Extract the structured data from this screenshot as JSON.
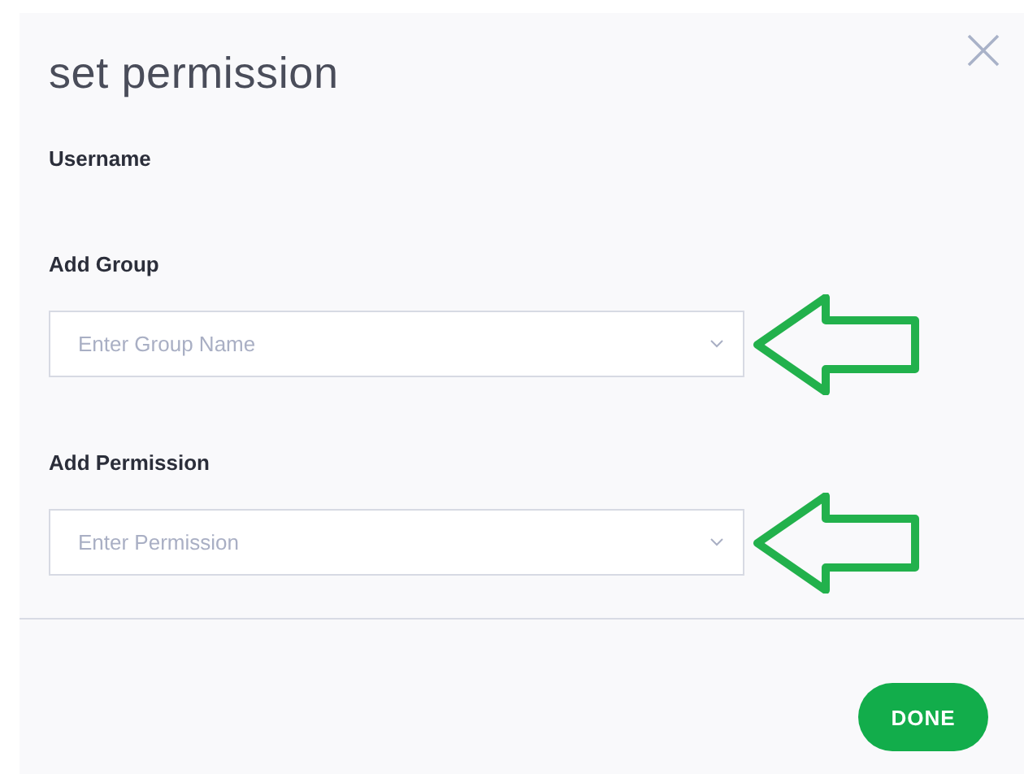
{
  "dialog": {
    "title": "set permission",
    "username_label": "Username",
    "fields": [
      {
        "label": "Add Group",
        "placeholder": "Enter Group Name"
      },
      {
        "label": "Add Permission",
        "placeholder": "Enter Permission"
      }
    ],
    "done_button": "DONE"
  }
}
